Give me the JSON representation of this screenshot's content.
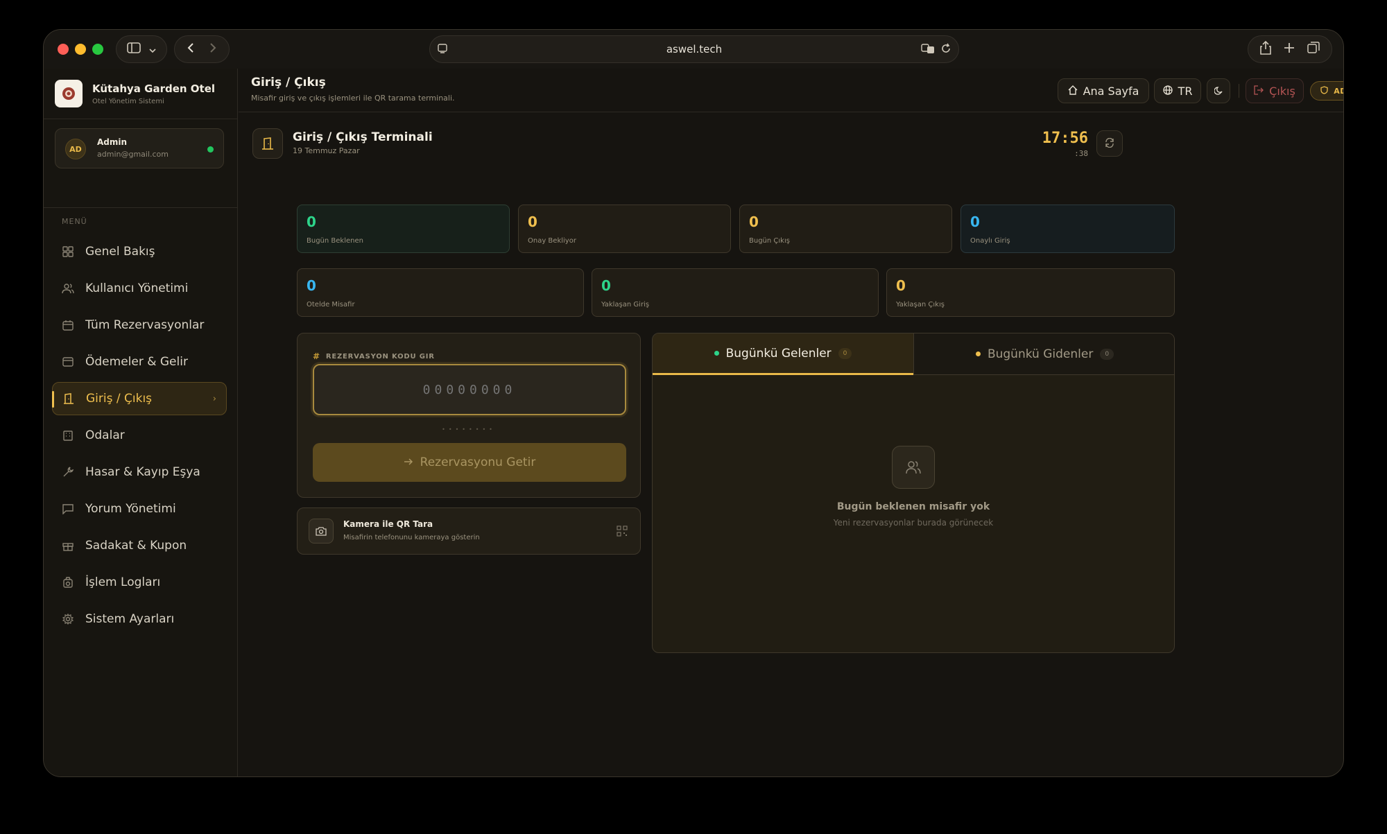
{
  "browser": {
    "url": "aswel.tech"
  },
  "brand": {
    "name": "Kütahya Garden Otel",
    "subtitle": "Otel Yönetim Sistemi"
  },
  "user": {
    "initials": "AD",
    "name": "Admin",
    "email": "admin@gmail.com",
    "status_color": "#22c55e"
  },
  "menu": {
    "label": "MENÜ",
    "items": [
      {
        "label": "Genel Bakış",
        "icon": "grid-icon"
      },
      {
        "label": "Kullanıcı Yönetimi",
        "icon": "users-icon"
      },
      {
        "label": "Tüm Rezervasyonlar",
        "icon": "calendar-icon"
      },
      {
        "label": "Ödemeler & Gelir",
        "icon": "credit-card-icon"
      },
      {
        "label": "Giriş / Çıkış",
        "icon": "door-icon",
        "active": true
      },
      {
        "label": "Odalar",
        "icon": "building-icon"
      },
      {
        "label": "Hasar & Kayıp Eşya",
        "icon": "wrench-icon"
      },
      {
        "label": "Yorum Yönetimi",
        "icon": "message-icon"
      },
      {
        "label": "Sadakat & Kupon",
        "icon": "gift-icon"
      },
      {
        "label": "İşlem Logları",
        "icon": "camera-log-icon"
      },
      {
        "label": "Sistem Ayarları",
        "icon": "gear-icon"
      }
    ]
  },
  "header": {
    "title": "Giriş / Çıkış",
    "subtitle": "Misafir giriş ve çıkış işlemleri ile QR tarama terminali.",
    "home_label": "Ana Sayfa",
    "lang_label": "TR",
    "logout_label": "Çıkış",
    "role_label": "ADMIN"
  },
  "terminal": {
    "title": "Giriş / Çıkış Terminali",
    "date": "19 Temmuz Pazar",
    "time": "17:56",
    "seconds": ":38"
  },
  "stats_row1": [
    {
      "value": "0",
      "label": "Bugün Beklenen",
      "color": "green"
    },
    {
      "value": "0",
      "label": "Onay Bekliyor",
      "color": "yellow"
    },
    {
      "value": "0",
      "label": "Bugün Çıkış",
      "color": "yellow"
    },
    {
      "value": "0",
      "label": "Onaylı Giriş",
      "color": "blue"
    }
  ],
  "stats_row2": [
    {
      "value": "0",
      "label": "Otelde Misafir",
      "color": "blue"
    },
    {
      "value": "0",
      "label": "Yaklaşan Giriş",
      "color": "green"
    },
    {
      "value": "0",
      "label": "Yaklaşan Çıkış",
      "color": "yellow"
    }
  ],
  "code_entry": {
    "label": "REZERVASYON KODU GIR",
    "placeholder": "00000000",
    "dots": "••••••••",
    "button_label": "Rezervasyonu Getir"
  },
  "qr": {
    "title": "Kamera ile QR Tara",
    "subtitle": "Misafirin telefonunu kameraya gösterin"
  },
  "tabs": {
    "arrivals_label": "Bugünkü Gelenler",
    "arrivals_count": "0",
    "departures_label": "Bugünkü Gidenler",
    "departures_count": "0"
  },
  "empty_state": {
    "title": "Bugün beklenen misafir yok",
    "subtitle": "Yeni rezervasyonlar burada görünecek"
  },
  "colors": {
    "accent": "#efbf4e",
    "green": "#2dd48a",
    "blue": "#38b6f0",
    "danger": "#b45454"
  }
}
